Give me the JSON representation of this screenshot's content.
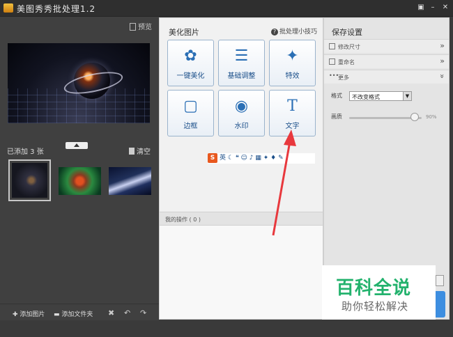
{
  "titlebar": {
    "title": "美图秀秀批处理1.2",
    "pin_icon": "pin-icon",
    "minimize_icon": "minimize-icon",
    "close_icon": "close-icon"
  },
  "left": {
    "preview_label": "预览",
    "added_count_label": "已添加 3 张",
    "clear_label": "清空",
    "bottom": {
      "add_image": "添加图片",
      "add_folder": "添加文件夹"
    }
  },
  "middle": {
    "title": "美化图片",
    "tips": "批处理小技巧",
    "tools": [
      {
        "label": "一键美化",
        "icon": "tulip-icon"
      },
      {
        "label": "基础调整",
        "icon": "sliders-icon"
      },
      {
        "label": "特效",
        "icon": "magic-wand-icon"
      },
      {
        "label": "边框",
        "icon": "frame-icon"
      },
      {
        "label": "水印",
        "icon": "watermark-icon"
      },
      {
        "label": "文字",
        "icon": "text-icon"
      }
    ],
    "ime": {
      "s": "S",
      "lang": "英"
    },
    "ops_label": "我的操作 ( 0 )"
  },
  "right": {
    "title": "保存设置",
    "sections": [
      "修改尺寸",
      "重命名",
      "更多"
    ],
    "format_label": "格式",
    "format_value": "不改变格式",
    "quality_label": "画质",
    "quality_value": "90%",
    "quality_level": 0.9
  },
  "watermark": {
    "big": "百科全说",
    "small": "助你轻松解决"
  },
  "colors": {
    "accent": "#2b6fb5",
    "watermark_green": "#23b26d",
    "arrow_red": "#e8383d"
  }
}
